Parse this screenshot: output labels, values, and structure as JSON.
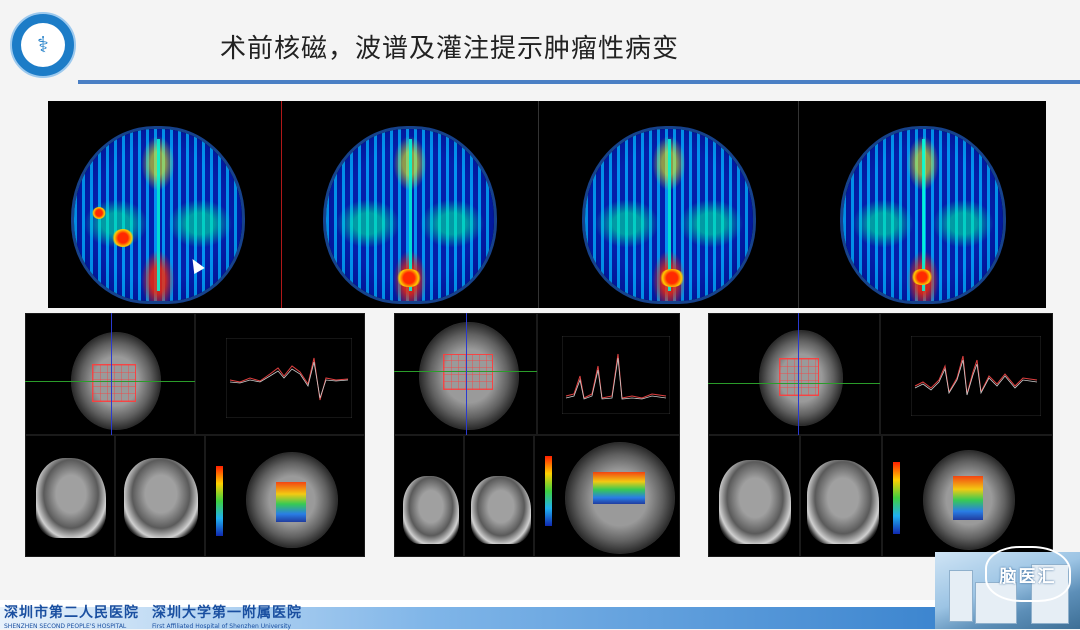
{
  "header": {
    "title": "术前核磁，波谱及灌注提示肿瘤性病变",
    "emblem_glyph": "⚕"
  },
  "footer": {
    "left_logo_cn": "深圳市第二人民医院",
    "left_logo_en": "SHENZHEN SECOND PEOPLE'S HOSPITAL",
    "right_logo_cn": "深圳大学第一附属医院",
    "right_logo_en": "First Affiliated Hospital of Shenzhen University",
    "badge_text": "脑医汇"
  },
  "colors": {
    "title_rule": "#4a7fc4",
    "footer_blue": "#2a78c8",
    "logo_blue": "#1a4fa0",
    "divider_red": "#b01818"
  },
  "icons": {
    "emblem": "medical-caduceus-icon",
    "cursor": "mouse-pointer-icon"
  }
}
